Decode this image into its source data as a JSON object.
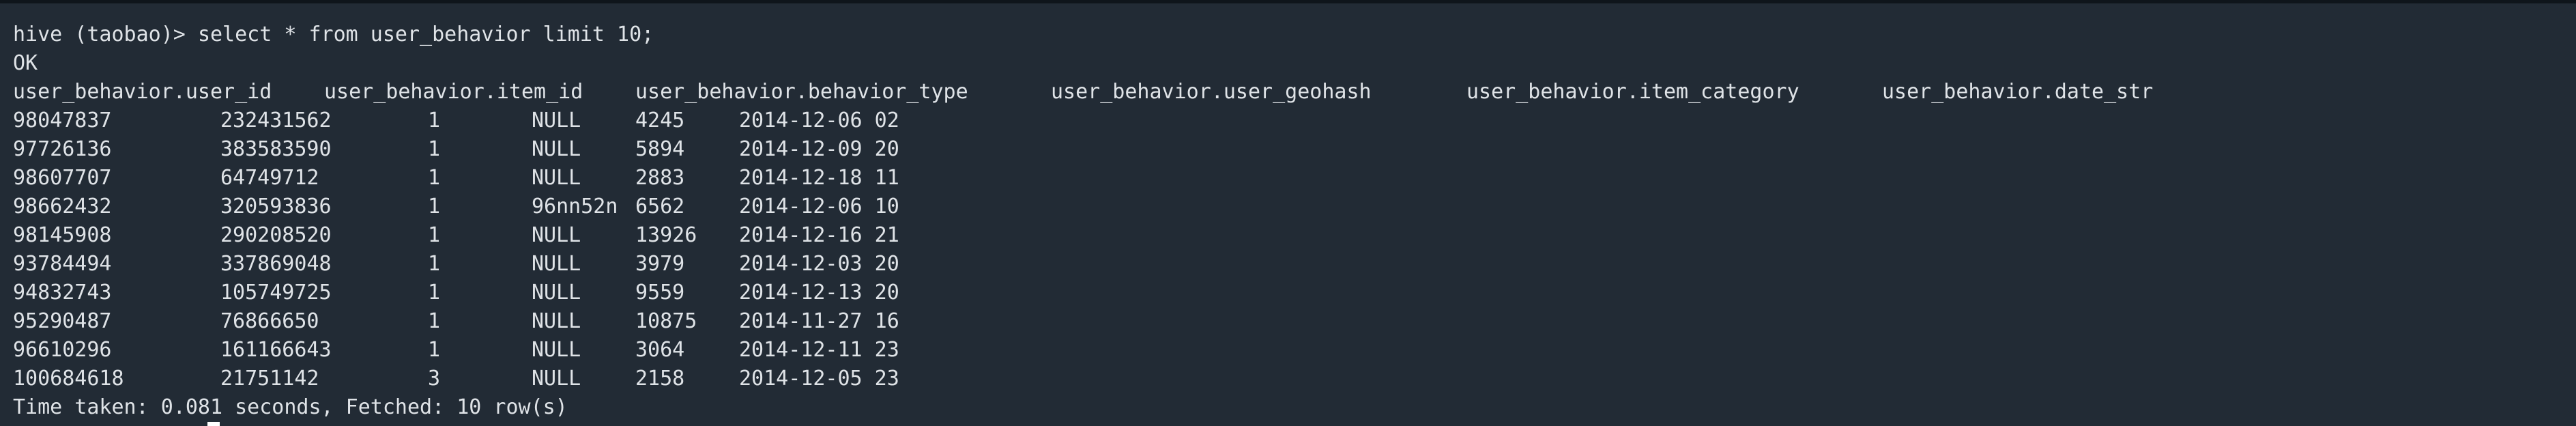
{
  "command": {
    "prompt": "hive (taobao)>",
    "query": "select * from user_behavior limit 10;"
  },
  "status": "OK",
  "table": {
    "headers": [
      "user_behavior.user_id",
      "user_behavior.item_id",
      "user_behavior.behavior_type",
      "user_behavior.user_geohash",
      "user_behavior.item_category",
      "user_behavior.date_str"
    ],
    "rows": [
      [
        "98047837",
        "232431562",
        "1",
        "NULL",
        "4245",
        "2014-12-06 02"
      ],
      [
        "97726136",
        "383583590",
        "1",
        "NULL",
        "5894",
        "2014-12-09 20"
      ],
      [
        "98607707",
        "64749712",
        "1",
        "NULL",
        "2883",
        "2014-12-18 11"
      ],
      [
        "98662432",
        "320593836",
        "1",
        "96nn52n",
        "6562",
        "2014-12-06 10"
      ],
      [
        "98145908",
        "290208520",
        "1",
        "NULL",
        "13926",
        "2014-12-16 21"
      ],
      [
        "93784494",
        "337869048",
        "1",
        "NULL",
        "3979",
        "2014-12-03 20"
      ],
      [
        "94832743",
        "105749725",
        "1",
        "NULL",
        "9559",
        "2014-12-13 20"
      ],
      [
        "95290487",
        "76866650",
        "1",
        "NULL",
        "10875",
        "2014-11-27 16"
      ],
      [
        "96610296",
        "161166643",
        "1",
        "NULL",
        "3064",
        "2014-12-11 23"
      ],
      [
        "100684618",
        "21751142",
        "3",
        "NULL",
        "2158",
        "2014-12-05 23"
      ]
    ]
  },
  "summary": "Time taken: 0.081 seconds, Fetched: 10 row(s)",
  "colors": {
    "background": "#222b35",
    "text": "#dfe3e7",
    "cursor": "#ffffff"
  }
}
